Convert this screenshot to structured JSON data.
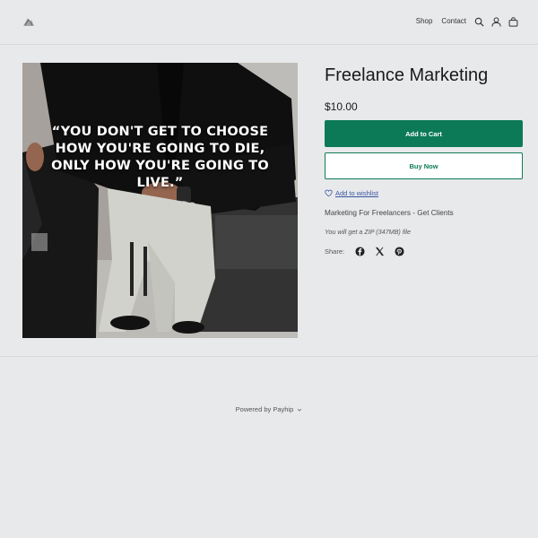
{
  "header": {
    "logo_icon": "brand-logo-icon",
    "nav": [
      "Shop",
      "Contact"
    ],
    "icons": [
      "search-icon",
      "account-icon",
      "bag-icon"
    ]
  },
  "product": {
    "title": "Freelance Marketing",
    "price": "$10.00",
    "image_quote": "“YOU DON'T GET TO CHOOSE HOW YOU'RE GOING TO DIE, ONLY HOW YOU'RE GOING TO LIVE.”",
    "add_to_cart": "Add to Cart",
    "buy_now": "Buy Now",
    "wishlist": "Add to wishlist",
    "description": "Marketing For Freelancers - Get Clients",
    "file_note": "You will get a ZIP (347MB) file",
    "share_label": "Share:",
    "share_icons": [
      "facebook-icon",
      "x-icon",
      "pinterest-icon"
    ]
  },
  "footer": {
    "powered_by": "Powered by Payhip"
  },
  "colors": {
    "accent": "#0d7a57",
    "background": "#e8e9eb"
  }
}
